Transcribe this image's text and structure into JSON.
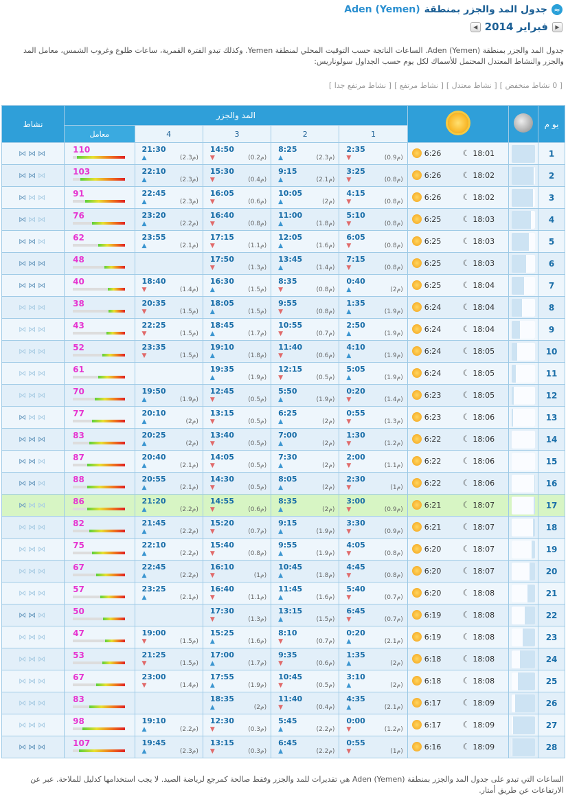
{
  "title": {
    "text": "جدول المد والجزر بمنطقة",
    "location": "Aden (Yemen)"
  },
  "month": {
    "label": "فبراير 2014"
  },
  "intro": "جدول المد والجزر بمنطقة Aden (Yemen). الساعات الناتجة حسب التوقيت المحلي لمنطقة Yemen. وكذلك تبدو الفترة القمرية، ساعات طلوع وغروب الشمس، معامل المد والجزر والنشاط المعتدل المحتمل للأسماك لكل يوم حسب الجداول سولوناريس:",
  "legend": [
    "[ 0 نشاط منخفض ]",
    "[ نشاط معتدل ]",
    "[ نشاط مرتفع ]",
    "[ نشاط مرتفع جدا ]"
  ],
  "headers": {
    "day": "يو م",
    "tide": "المد والجزر",
    "activity": "نشاط",
    "coef": "معامل",
    "col1": "1",
    "col2": "2",
    "col3": "3",
    "col4": "4"
  },
  "rows": [
    {
      "day": "1",
      "sunrise": "6:26",
      "sunset": "18:01",
      "t": [
        [
          "2:35",
          "(0.9م)",
          "d"
        ],
        [
          "8:25",
          "(2.3م)",
          "u"
        ],
        [
          "14:50",
          "(0.2م)",
          "d"
        ],
        [
          "21:30",
          "(2.3م)",
          "u"
        ]
      ],
      "coef": "110",
      "coefv": 110,
      "act": 3
    },
    {
      "day": "2",
      "sunrise": "6:26",
      "sunset": "18:02",
      "t": [
        [
          "3:25",
          "(0.8م)",
          "d"
        ],
        [
          "9:15",
          "(2.1م)",
          "u"
        ],
        [
          "15:30",
          "(0.4م)",
          "d"
        ],
        [
          "22:10",
          "(2.3م)",
          "u"
        ]
      ],
      "coef": "103",
      "coefv": 103,
      "act": 2
    },
    {
      "day": "3",
      "sunrise": "6:26",
      "sunset": "18:02",
      "t": [
        [
          "4:15",
          "(0.8م)",
          "d"
        ],
        [
          "10:05",
          "(2م)",
          "u"
        ],
        [
          "16:05",
          "(0.6م)",
          "d"
        ],
        [
          "22:45",
          "(2.3م)",
          "u"
        ]
      ],
      "coef": "91",
      "coefv": 91,
      "act": 1
    },
    {
      "day": "4",
      "sunrise": "6:25",
      "sunset": "18:03",
      "t": [
        [
          "5:10",
          "(0.8م)",
          "d"
        ],
        [
          "11:00",
          "(1.8م)",
          "u"
        ],
        [
          "16:40",
          "(0.8م)",
          "d"
        ],
        [
          "23:20",
          "(2.2م)",
          "u"
        ]
      ],
      "coef": "76",
      "coefv": 76,
      "act": 1
    },
    {
      "day": "5",
      "sunrise": "6:25",
      "sunset": "18:03",
      "t": [
        [
          "6:05",
          "(0.8م)",
          "d"
        ],
        [
          "12:05",
          "(1.6م)",
          "u"
        ],
        [
          "17:15",
          "(1.1م)",
          "d"
        ],
        [
          "23:55",
          "(2.1م)",
          "u"
        ]
      ],
      "coef": "62",
      "coefv": 62,
      "act": 2
    },
    {
      "day": "6",
      "sunrise": "6:25",
      "sunset": "18:03",
      "t": [
        [
          "7:15",
          "(0.8م)",
          "d"
        ],
        [
          "13:45",
          "(1.4م)",
          "u"
        ],
        [
          "17:50",
          "(1.3م)",
          "d"
        ],
        [
          "",
          "",
          " "
        ]
      ],
      "coef": "48",
      "coefv": 48,
      "act": 3
    },
    {
      "day": "7",
      "sunrise": "6:25",
      "sunset": "18:04",
      "t": [
        [
          "0:40",
          "(2م)",
          "u"
        ],
        [
          "8:35",
          "(0.8م)",
          "d"
        ],
        [
          "16:30",
          "(1.5م)",
          "u"
        ],
        [
          "18:40",
          "(1.4م)",
          "d"
        ]
      ],
      "coef": "40",
      "coefv": 40,
      "act": 3
    },
    {
      "day": "8",
      "sunrise": "6:24",
      "sunset": "18:04",
      "t": [
        [
          "1:35",
          "(1.9م)",
          "u"
        ],
        [
          "9:55",
          "(0.8م)",
          "d"
        ],
        [
          "18:05",
          "(1.5م)",
          "u"
        ],
        [
          "20:35",
          "(1.5م)",
          "d"
        ]
      ],
      "coef": "38",
      "coefv": 38,
      "act": 0
    },
    {
      "day": "9",
      "sunrise": "6:24",
      "sunset": "18:04",
      "t": [
        [
          "2:50",
          "(1.9م)",
          "u"
        ],
        [
          "10:55",
          "(0.7م)",
          "d"
        ],
        [
          "18:45",
          "(1.7م)",
          "u"
        ],
        [
          "22:25",
          "(1.5م)",
          "d"
        ]
      ],
      "coef": "43",
      "coefv": 43,
      "act": 0
    },
    {
      "day": "10",
      "sunrise": "6:24",
      "sunset": "18:05",
      "t": [
        [
          "4:10",
          "(1.9م)",
          "u"
        ],
        [
          "11:40",
          "(0.6م)",
          "d"
        ],
        [
          "19:10",
          "(1.8م)",
          "u"
        ],
        [
          "23:35",
          "(1.5م)",
          "d"
        ]
      ],
      "coef": "52",
      "coefv": 52,
      "act": 0
    },
    {
      "day": "11",
      "sunrise": "6:24",
      "sunset": "18:05",
      "t": [
        [
          "5:05",
          "(1.9م)",
          "u"
        ],
        [
          "12:15",
          "(0.5م)",
          "d"
        ],
        [
          "19:35",
          "(1.9م)",
          "u"
        ],
        [
          "",
          "",
          " "
        ]
      ],
      "coef": "61",
      "coefv": 61,
      "act": 0
    },
    {
      "day": "12",
      "sunrise": "6:23",
      "sunset": "18:05",
      "t": [
        [
          "0:20",
          "(1.4م)",
          "d"
        ],
        [
          "5:50",
          "(1.9م)",
          "u"
        ],
        [
          "12:45",
          "(0.5م)",
          "d"
        ],
        [
          "19:50",
          "(1.9م)",
          "u"
        ]
      ],
      "coef": "70",
      "coefv": 70,
      "act": 0
    },
    {
      "day": "13",
      "sunrise": "6:23",
      "sunset": "18:06",
      "t": [
        [
          "0:55",
          "(1.3م)",
          "d"
        ],
        [
          "6:25",
          "(2م)",
          "u"
        ],
        [
          "13:15",
          "(0.5م)",
          "d"
        ],
        [
          "20:10",
          "(2م)",
          "u"
        ]
      ],
      "coef": "77",
      "coefv": 77,
      "act": 1
    },
    {
      "day": "14",
      "sunrise": "6:22",
      "sunset": "18:06",
      "t": [
        [
          "1:30",
          "(1.2م)",
          "d"
        ],
        [
          "7:00",
          "(2م)",
          "u"
        ],
        [
          "13:40",
          "(0.5م)",
          "d"
        ],
        [
          "20:25",
          "(2م)",
          "u"
        ]
      ],
      "coef": "83",
      "coefv": 83,
      "act": 3
    },
    {
      "day": "15",
      "sunrise": "6:22",
      "sunset": "18:06",
      "t": [
        [
          "2:00",
          "(1.1م)",
          "d"
        ],
        [
          "7:30",
          "(2م)",
          "u"
        ],
        [
          "14:05",
          "(0.5م)",
          "d"
        ],
        [
          "20:40",
          "(2.1م)",
          "u"
        ]
      ],
      "coef": "87",
      "coefv": 87,
      "act": 2
    },
    {
      "day": "16",
      "sunrise": "6:22",
      "sunset": "18:06",
      "t": [
        [
          "2:30",
          "(1م)",
          "d"
        ],
        [
          "8:05",
          "(2م)",
          "u"
        ],
        [
          "14:30",
          "(0.5م)",
          "d"
        ],
        [
          "20:55",
          "(2.1م)",
          "u"
        ]
      ],
      "coef": "88",
      "coefv": 88,
      "act": 2
    },
    {
      "day": "17",
      "sunrise": "6:21",
      "sunset": "18:07",
      "t": [
        [
          "3:00",
          "(0.9م)",
          "d"
        ],
        [
          "8:35",
          "(2م)",
          "u"
        ],
        [
          "14:55",
          "(0.6م)",
          "d"
        ],
        [
          "21:20",
          "(2.2م)",
          "u"
        ]
      ],
      "coef": "86",
      "coefv": 86,
      "act": 1,
      "today": true
    },
    {
      "day": "18",
      "sunrise": "6:21",
      "sunset": "18:07",
      "t": [
        [
          "3:30",
          "(0.9م)",
          "d"
        ],
        [
          "9:15",
          "(1.9م)",
          "u"
        ],
        [
          "15:20",
          "(0.7م)",
          "d"
        ],
        [
          "21:45",
          "(2.2م)",
          "u"
        ]
      ],
      "coef": "82",
      "coefv": 82,
      "act": 0
    },
    {
      "day": "19",
      "sunrise": "6:20",
      "sunset": "18:07",
      "t": [
        [
          "4:05",
          "(0.8م)",
          "d"
        ],
        [
          "9:55",
          "(1.9م)",
          "u"
        ],
        [
          "15:40",
          "(0.8م)",
          "d"
        ],
        [
          "22:10",
          "(2.2م)",
          "u"
        ]
      ],
      "coef": "75",
      "coefv": 75,
      "act": 0
    },
    {
      "day": "20",
      "sunrise": "6:20",
      "sunset": "18:07",
      "t": [
        [
          "4:45",
          "(0.8م)",
          "d"
        ],
        [
          "10:45",
          "(1.8م)",
          "u"
        ],
        [
          "16:10",
          "(1م)",
          "d"
        ],
        [
          "22:45",
          "(2.2م)",
          "u"
        ]
      ],
      "coef": "67",
      "coefv": 67,
      "act": 0
    },
    {
      "day": "21",
      "sunrise": "6:20",
      "sunset": "18:08",
      "t": [
        [
          "5:40",
          "(0.7م)",
          "d"
        ],
        [
          "11:45",
          "(1.6م)",
          "u"
        ],
        [
          "16:40",
          "(1.1م)",
          "d"
        ],
        [
          "23:25",
          "(2.1م)",
          "u"
        ]
      ],
      "coef": "57",
      "coefv": 57,
      "act": 0
    },
    {
      "day": "22",
      "sunrise": "6:19",
      "sunset": "18:08",
      "t": [
        [
          "6:45",
          "(0.7م)",
          "d"
        ],
        [
          "13:15",
          "(1.5م)",
          "u"
        ],
        [
          "17:30",
          "(1.3م)",
          "d"
        ],
        [
          "",
          "",
          " "
        ]
      ],
      "coef": "50",
      "coefv": 50,
      "act": 2
    },
    {
      "day": "23",
      "sunrise": "6:19",
      "sunset": "18:08",
      "t": [
        [
          "0:20",
          "(2.1م)",
          "u"
        ],
        [
          "8:10",
          "(0.7م)",
          "d"
        ],
        [
          "15:25",
          "(1.6م)",
          "u"
        ],
        [
          "19:00",
          "(1.5م)",
          "d"
        ]
      ],
      "coef": "47",
      "coefv": 47,
      "act": 0
    },
    {
      "day": "24",
      "sunrise": "6:18",
      "sunset": "18:08",
      "t": [
        [
          "1:35",
          "(2م)",
          "u"
        ],
        [
          "9:35",
          "(0.6م)",
          "d"
        ],
        [
          "17:00",
          "(1.7م)",
          "u"
        ],
        [
          "21:25",
          "(1.5م)",
          "d"
        ]
      ],
      "coef": "53",
      "coefv": 53,
      "act": 0
    },
    {
      "day": "25",
      "sunrise": "6:18",
      "sunset": "18:08",
      "t": [
        [
          "3:10",
          "(2م)",
          "u"
        ],
        [
          "10:45",
          "(0.5م)",
          "d"
        ],
        [
          "17:55",
          "(1.9م)",
          "u"
        ],
        [
          "23:00",
          "(1.4م)",
          "d"
        ]
      ],
      "coef": "67",
      "coefv": 67,
      "act": 0
    },
    {
      "day": "26",
      "sunrise": "6:17",
      "sunset": "18:09",
      "t": [
        [
          "4:35",
          "(2.1م)",
          "u"
        ],
        [
          "11:40",
          "(0.4م)",
          "d"
        ],
        [
          "18:35",
          "(2م)",
          "u"
        ],
        [
          "",
          "",
          " "
        ]
      ],
      "coef": "83",
      "coefv": 83,
      "act": 0
    },
    {
      "day": "27",
      "sunrise": "6:17",
      "sunset": "18:09",
      "t": [
        [
          "0:00",
          "(1.2م)",
          "d"
        ],
        [
          "5:45",
          "(2.2م)",
          "u"
        ],
        [
          "12:30",
          "(0.3م)",
          "d"
        ],
        [
          "19:10",
          "(2.2م)",
          "u"
        ]
      ],
      "coef": "98",
      "coefv": 98,
      "act": 0
    },
    {
      "day": "28",
      "sunrise": "6:16",
      "sunset": "18:09",
      "t": [
        [
          "0:55",
          "(1م)",
          "d"
        ],
        [
          "6:45",
          "(2.2م)",
          "u"
        ],
        [
          "13:15",
          "(0.3م)",
          "d"
        ],
        [
          "19:45",
          "(2.3م)",
          "u"
        ]
      ],
      "coef": "107",
      "coefv": 107,
      "act": 3
    }
  ],
  "moon_phase": [
    0.0,
    0.05,
    0.1,
    0.18,
    0.27,
    0.37,
    0.47,
    0.57,
    0.66,
    0.75,
    0.83,
    0.9,
    0.95,
    0.99,
    1.0,
    0.98,
    0.95,
    0.9,
    0.84,
    0.76,
    0.67,
    0.57,
    0.46,
    0.35,
    0.25,
    0.15,
    0.07,
    0.02
  ],
  "footer": "الساعات التي تبدو على جدول المد والجزر بمنطقة Aden (Yemen) هي تقديرات للمد والجزر وفقط صالحة كمرجع لرياضة الصيد. لا يجب استخدامها كدليل للملاحة. عبر عن الارتفاعات عن طريق أمتار.",
  "colors": {
    "header": "#2f9fd9",
    "coef": "#e636d0",
    "today": "#d7f5c4"
  }
}
